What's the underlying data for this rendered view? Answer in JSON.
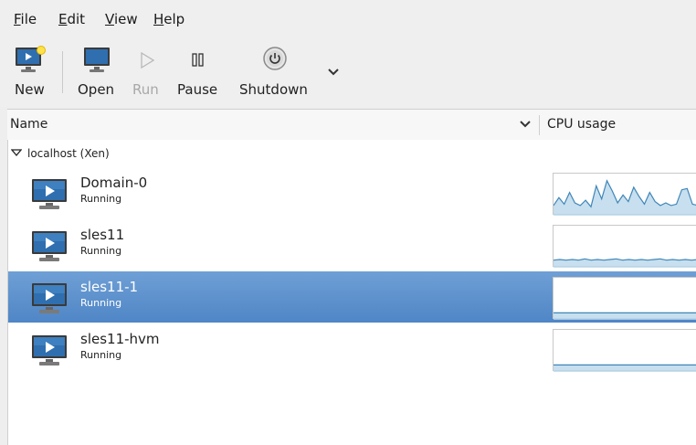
{
  "menu": {
    "file": {
      "mnemonic": "F",
      "rest": "ile"
    },
    "edit": {
      "mnemonic": "E",
      "rest": "dit"
    },
    "view": {
      "mnemonic": "V",
      "rest": "iew"
    },
    "help": {
      "mnemonic": "H",
      "rest": "elp"
    }
  },
  "toolbar": {
    "new_label": "New",
    "open_label": "Open",
    "run_label": "Run",
    "pause_label": "Pause",
    "shutdown_label": "Shutdown",
    "more_icon": "chevron-down-icon",
    "disabled_color": "#a8a8a8"
  },
  "header": {
    "name_label": "Name",
    "cpu_label": "CPU usage",
    "sort_icon": "chevron-down-icon"
  },
  "host": {
    "label": "localhost (Xen)",
    "expanded": true
  },
  "vms": [
    {
      "name": "Domain-0",
      "status": "Running",
      "selected": false,
      "cpu": [
        10,
        22,
        12,
        30,
        14,
        10,
        18,
        8,
        40,
        20,
        48,
        32,
        14,
        26,
        16,
        38,
        24,
        12,
        30,
        16,
        10,
        14,
        10,
        12,
        34,
        36,
        12,
        10
      ]
    },
    {
      "name": "sles11",
      "status": "Running",
      "selected": false,
      "cpu": [
        6,
        7,
        6,
        7,
        6,
        8,
        6,
        7,
        6,
        7,
        8,
        6,
        7,
        6,
        7,
        6,
        7,
        8,
        6,
        7,
        6,
        7,
        6,
        7
      ]
    },
    {
      "name": "sles11-1",
      "status": "Running",
      "selected": true,
      "cpu": [
        5,
        5,
        5,
        5,
        5,
        5,
        5,
        5,
        5,
        5,
        5,
        5,
        5,
        5,
        5,
        5,
        5,
        5,
        5,
        5
      ]
    },
    {
      "name": "sles11-hvm",
      "status": "Running",
      "selected": false,
      "cpu": [
        5,
        5,
        5,
        5,
        5,
        5,
        5,
        5,
        5,
        5,
        5,
        5,
        5,
        5,
        5,
        5,
        5,
        5,
        5,
        5
      ]
    }
  ],
  "colors": {
    "selection": "#5a8ecb",
    "graph_line": "#3f86b8",
    "graph_fill": "#b9d7ea",
    "monitor_blue": "#2f6fb0"
  }
}
